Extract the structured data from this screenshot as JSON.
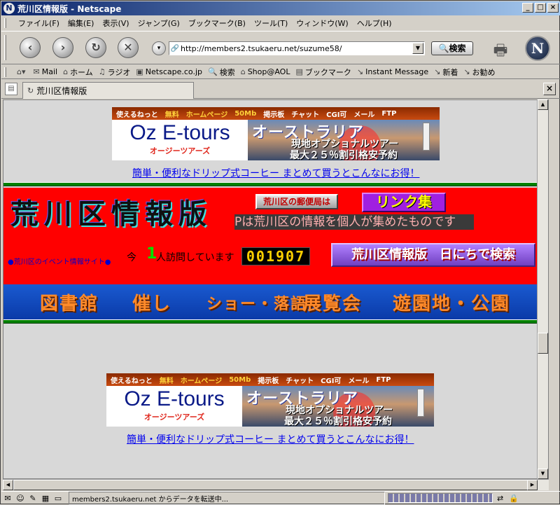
{
  "window": {
    "title": "荒川区情報版 - Netscape",
    "app_icon": "N"
  },
  "menu": [
    "ファイル(F)",
    "編集(E)",
    "表示(V)",
    "ジャンプ(G)",
    "ブックマーク(B)",
    "ツール(T)",
    "ウィンドウ(W)",
    "ヘルプ(H)"
  ],
  "nav": {
    "url": "http://members2.tsukaeru.net/suzume58/",
    "search_label": "検索",
    "logo": "N"
  },
  "personal_toolbar": [
    {
      "icon": "mail-icon",
      "label": "Mail"
    },
    {
      "icon": "home-icon",
      "label": "ホーム"
    },
    {
      "icon": "radio-icon",
      "label": "ラジオ"
    },
    {
      "icon": "my-icon",
      "label": "Netscape.co.jp"
    },
    {
      "icon": "search-icon",
      "label": "検索"
    },
    {
      "icon": "shop-icon",
      "label": "Shop@AOL"
    },
    {
      "icon": "bookmark-icon",
      "label": "ブックマーク"
    },
    {
      "icon": "im-icon",
      "label": "Instant Message"
    },
    {
      "icon": "new-icon",
      "label": "新着"
    },
    {
      "icon": "recommend-icon",
      "label": "お勧め"
    }
  ],
  "tab": {
    "title": "荒川区情報版"
  },
  "page": {
    "banner": {
      "top_items": [
        "使えるねっと",
        "無料",
        "ホームページ",
        "50Mb",
        "掲示板",
        "チャット",
        "CGI可",
        "メール",
        "FTP"
      ],
      "brand": "Oz E-tours",
      "brand_sub": "オージーツアーズ",
      "headline": "オーストラリア",
      "line2": "現地オプショナルツアー",
      "line3": "最大２５％割引格安予約"
    },
    "ad_link": "簡単・便利なドリップ式コーヒー まとめて買うとこんなにお得！",
    "site_title": "荒川区情報版",
    "post_office_btn": "荒川区の郵便局は",
    "links_btn": "リンク集",
    "marquee": "Pは荒川区の情報を個人が集めたものです",
    "event_link": "●荒川区のイベント情報サイト●",
    "visit_prefix": "今",
    "visit_num": "1",
    "visit_suffix": "人訪問しています",
    "counter": "001907",
    "search_day_btn": "荒川区情報版　日にちで検索",
    "categories": [
      "図書館",
      "催し",
      "ショー・落語",
      "展覧会",
      "遊園地・公園"
    ]
  },
  "status": {
    "text": "members2.tsukaeru.net からデータを転送中..."
  }
}
